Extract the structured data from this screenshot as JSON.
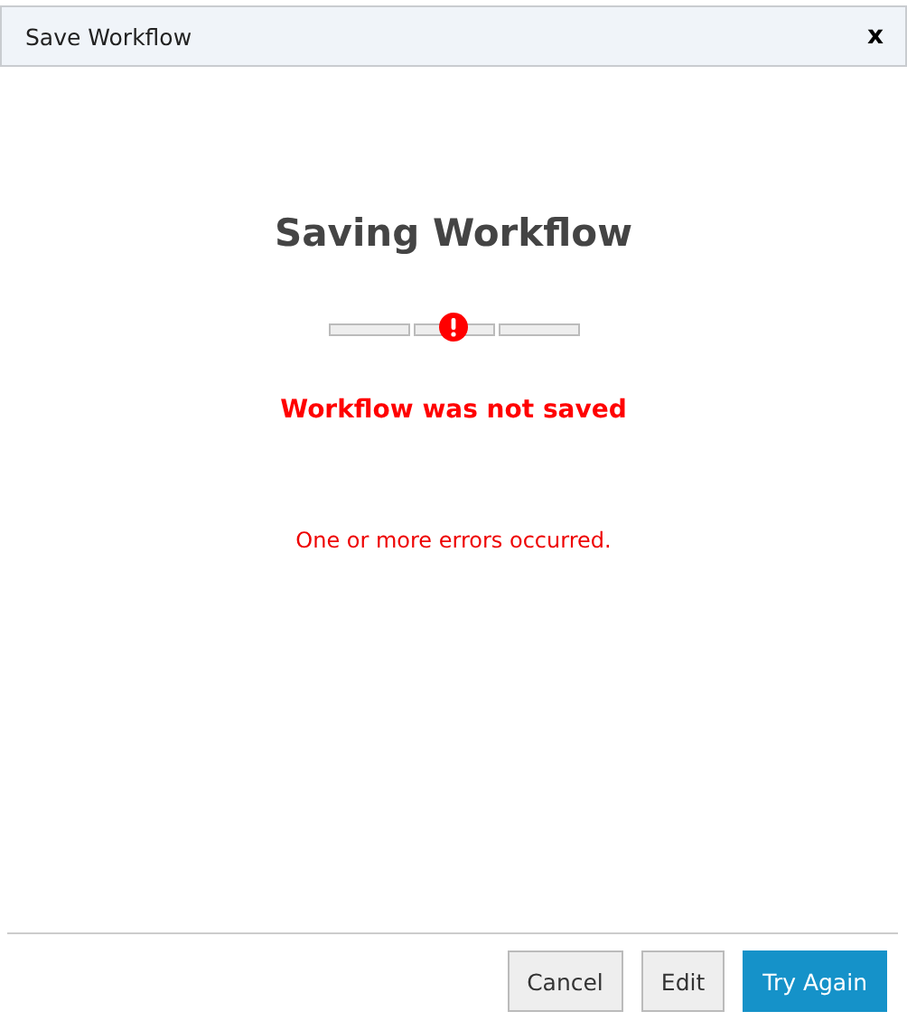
{
  "window": {
    "title": "Save Workflow",
    "close": "x"
  },
  "heading": "Saving Workflow",
  "progress": {
    "steps": [
      {
        "error": false
      },
      {
        "error": true
      },
      {
        "error": false
      }
    ]
  },
  "status": "Workflow was not saved",
  "message": "One or more errors occurred.",
  "buttons": [
    {
      "label": "Cancel",
      "kind": "secondary"
    },
    {
      "label": "Edit",
      "kind": "secondary"
    },
    {
      "label": "Try Again",
      "kind": "primary"
    }
  ]
}
